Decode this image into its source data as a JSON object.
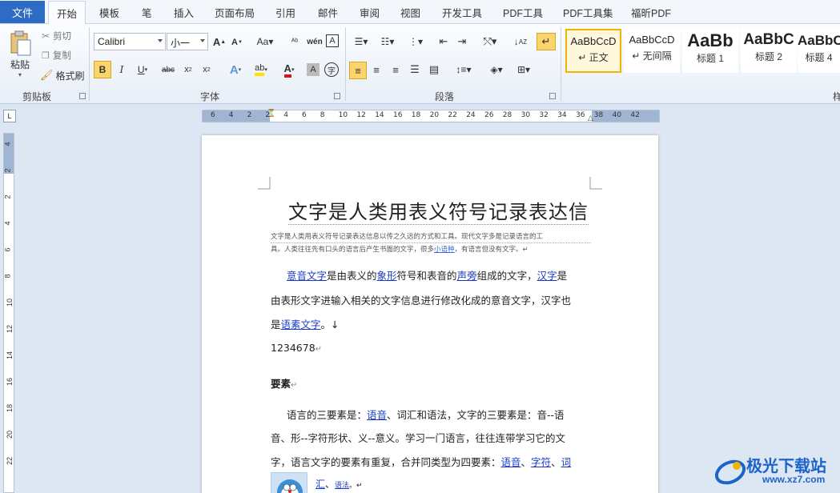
{
  "menu": {
    "file": "文件",
    "tabs": [
      "开始",
      "模板",
      "笔",
      "插入",
      "页面布局",
      "引用",
      "邮件",
      "审阅",
      "视图",
      "开发工具",
      "PDF工具",
      "PDF工具集",
      "福昕PDF"
    ]
  },
  "clipboard": {
    "paste": "粘贴",
    "cut": "剪切",
    "copy": "复制",
    "format_painter": "格式刷",
    "group_label": "剪贴板"
  },
  "font": {
    "font_name": "Calibri",
    "font_size": "小一",
    "group_label": "字体"
  },
  "paragraph": {
    "group_label": "段落"
  },
  "styles": {
    "items": [
      {
        "sample": "AaBbCcD",
        "name": "↵ 正文"
      },
      {
        "sample": "AaBbCcD",
        "name": "↵ 无间隔"
      },
      {
        "sample": "AaBb",
        "name": "标题 1"
      },
      {
        "sample": "AaBbC",
        "name": "标题 2"
      },
      {
        "sample": "AaBbC",
        "name": "标题 4"
      }
    ],
    "group_label_partial": "样"
  },
  "ruler": {
    "h_numbers": [
      "6",
      "4",
      "2",
      "2",
      "4",
      "6",
      "8",
      "10",
      "12",
      "14",
      "16",
      "18",
      "20",
      "22",
      "24",
      "26",
      "28",
      "30",
      "32",
      "34",
      "36",
      "38",
      "40",
      "42"
    ],
    "v_numbers": [
      "4",
      "2",
      "2",
      "4",
      "6",
      "8",
      "10",
      "12",
      "14",
      "16",
      "18",
      "20",
      "22"
    ]
  },
  "document": {
    "title": "文字是人类用表义符号记录表达信",
    "small_line_1": "文字是人类用表义符号记录表达信息以传之久远的方式和工具。现代文字多是记录语言的工",
    "small_line_2a": "具。人类往往先有口头的语言后产生书面的文字，很多",
    "small_line_2_link": "小语种",
    "small_line_2b": "，有语言但没有文字。↵",
    "p1_l1_a": "意音文字",
    "p1_l1_b": "是由表义的",
    "p1_l1_c": "象形",
    "p1_l1_d": "符号和表音的",
    "p1_l1_e": "声旁",
    "p1_l1_f": "组成的文字，",
    "p1_l1_g": "汉字",
    "p1_l1_h": "是",
    "p1_l2": "由表形文字进输入相关的文字信息进行修改化成的意音文字，汉字也",
    "p1_l3_a": "是",
    "p1_l3_b": "语素文字",
    "p1_l3_c": "。↓",
    "number_line": "1234678",
    "heading": "要素",
    "p2_l1_a": "语言的三要素是：",
    "p2_l1_b": "语音",
    "p2_l1_c": "、词汇和语法，文字的三要素是：音--语",
    "p2_l2": "音、形--字符形状、义--意义。学习一门语言，往往连带学习它的文",
    "p2_l3_a": "字，语言文字的要素有重复，合并同类型为四要素：",
    "p2_l3_b": "语音",
    "p2_l3_c": "、",
    "p2_l3_d": "字符",
    "p2_l3_e": "、",
    "p2_l3_f": "词",
    "p2_l4_a": "汇",
    "p2_l4_b": "、",
    "p2_l4_c": "语法",
    "p2_l4_d": "。↵"
  },
  "watermark": {
    "text": "极光下载站",
    "url": "www.xz7.com"
  },
  "colors": {
    "file_blue": "#2d6bc4",
    "link": "#1a3cc4",
    "accent_gold": "#f0b400"
  }
}
